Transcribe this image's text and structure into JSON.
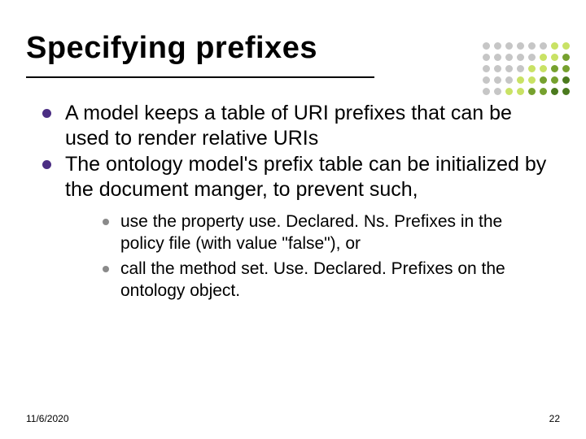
{
  "title": "Specifying prefixes",
  "bullets": {
    "b1": "A model keeps a table of URI prefixes that can be used to render relative URIs",
    "b2": "The ontology model's prefix table can be initialized by the document manger, to prevent such,",
    "sub1": "use the property use. Declared. Ns. Prefixes in the policy file (with value \"false\"), or",
    "sub2": "call the method set. Use. Declared. Prefixes on the ontology object."
  },
  "footer": {
    "date": "11/6/2020",
    "page": "22"
  },
  "decor": {
    "dot_colors": [
      "#c6c6c6",
      "#c6c6c6",
      "#c6c6c6",
      "#c6c6c6",
      "#c6c6c6",
      "#c6c6c6",
      "#c9e265",
      "#c9e265",
      "#c6c6c6",
      "#c6c6c6",
      "#c6c6c6",
      "#c6c6c6",
      "#c6c6c6",
      "#c9e265",
      "#c9e265",
      "#76a12e",
      "#c6c6c6",
      "#c6c6c6",
      "#c6c6c6",
      "#c6c6c6",
      "#c9e265",
      "#c9e265",
      "#76a12e",
      "#76a12e",
      "#c6c6c6",
      "#c6c6c6",
      "#c6c6c6",
      "#c9e265",
      "#c9e265",
      "#76a12e",
      "#76a12e",
      "#4b7a1e",
      "#c6c6c6",
      "#c6c6c6",
      "#c9e265",
      "#c9e265",
      "#76a12e",
      "#76a12e",
      "#4b7a1e",
      "#4b7a1e"
    ]
  }
}
